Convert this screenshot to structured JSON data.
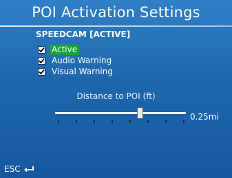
{
  "header": {
    "title": "POI Activation Settings"
  },
  "section": {
    "label": "SPEEDCAM [ACTIVE]"
  },
  "options": [
    {
      "label": "Active",
      "checked": true,
      "highlighted": true
    },
    {
      "label": "Audio Warning",
      "checked": true,
      "highlighted": false
    },
    {
      "label": "Visual Warning",
      "checked": true,
      "highlighted": false
    }
  ],
  "distance": {
    "label": "Distance to POI (ft)",
    "value_text": "0.25mi",
    "slider_position": 0.65,
    "tick_count": 8
  },
  "footer": {
    "esc_label": "ESC",
    "esc_icon": "return-arrow-icon"
  },
  "colors": {
    "background": "#1f67ad",
    "highlight": "#19a23a",
    "text": "#ffffff"
  }
}
